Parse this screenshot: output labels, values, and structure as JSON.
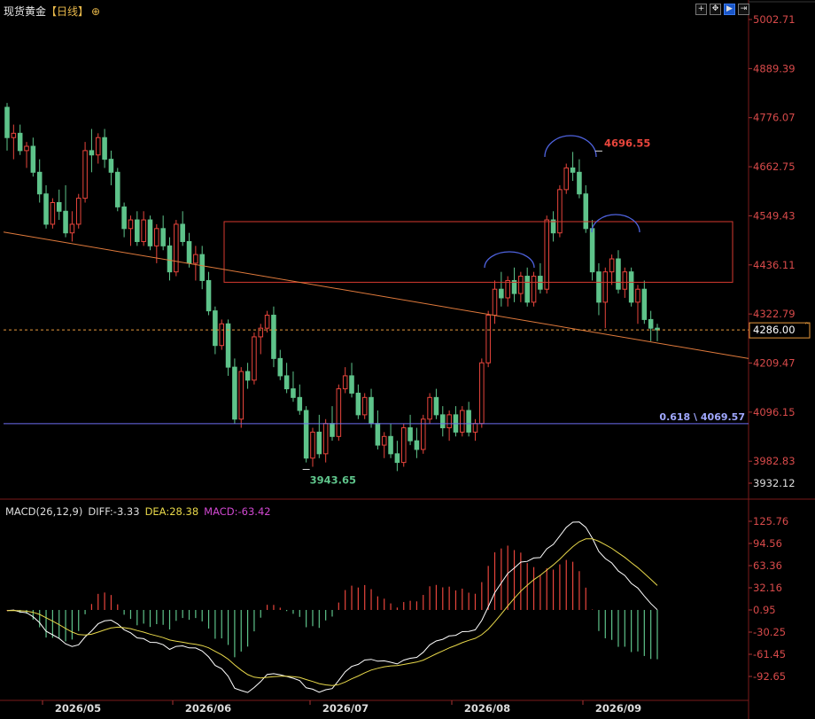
{
  "header": {
    "instrument": "现货黄金",
    "period": "【日线】",
    "add_icon": "plus-circle-icon"
  },
  "toolbar": {
    "buttons": [
      "crosshair-icon",
      "move-icon",
      "play-icon",
      "scroll-icon"
    ]
  },
  "price_axis": {
    "ticks": [
      "5002.71",
      "4889.39",
      "4776.07",
      "4662.75",
      "4549.43",
      "4436.11",
      "4322.79",
      "4209.47",
      "4096.15",
      "3982.83",
      "3932.12"
    ],
    "current_price": "4286.00"
  },
  "annotations": {
    "high_label": "4696.55",
    "low_label": "3943.65",
    "fib_label": "0.618 \\ 4069.57"
  },
  "macd": {
    "name": "MACD(26,12,9)",
    "diff": "DIFF:-3.33",
    "dea": "DEA:28.38",
    "macd": "MACD:-63.42",
    "ticks": [
      "125.76",
      "94.56",
      "63.36",
      "32.16",
      "0.95",
      "-30.25",
      "-61.45",
      "-92.65"
    ]
  },
  "time_axis": {
    "labels": [
      "2026/05",
      "2026/06",
      "2026/07",
      "2026/08",
      "2026/09"
    ]
  },
  "colors": {
    "up": "#e8453c",
    "down": "#5ec38a",
    "rect": "#d63a2f",
    "trendline": "#e07a3c",
    "fib": "#6e6ef0",
    "arc": "#4f63e0",
    "current": "#e89a3c",
    "diff": "#ffffff",
    "dea": "#e8d84a"
  },
  "chart_data": {
    "type": "candlestick",
    "x": [
      "2026/05",
      "2026/06",
      "2026/07",
      "2026/08",
      "2026/09"
    ],
    "ylim": [
      3932.12,
      5002.71
    ],
    "high": 4696.55,
    "low": 3943.65,
    "fib": {
      "ratio": 0.618,
      "value": 4069.57
    },
    "last": 4286.0,
    "rect_range": [
      4396,
      4536
    ],
    "candles": [
      [
        4800,
        4810,
        4700,
        4730
      ],
      [
        4730,
        4760,
        4680,
        4740
      ],
      [
        4740,
        4760,
        4690,
        4700
      ],
      [
        4700,
        4720,
        4660,
        4710
      ],
      [
        4710,
        4730,
        4640,
        4650
      ],
      [
        4650,
        4680,
        4580,
        4600
      ],
      [
        4600,
        4620,
        4520,
        4530
      ],
      [
        4530,
        4590,
        4520,
        4580
      ],
      [
        4580,
        4610,
        4540,
        4560
      ],
      [
        4560,
        4620,
        4500,
        4510
      ],
      [
        4510,
        4560,
        4490,
        4530
      ],
      [
        4530,
        4600,
        4520,
        4590
      ],
      [
        4590,
        4720,
        4580,
        4700
      ],
      [
        4700,
        4750,
        4650,
        4690
      ],
      [
        4690,
        4740,
        4670,
        4730
      ],
      [
        4730,
        4750,
        4660,
        4680
      ],
      [
        4680,
        4700,
        4620,
        4650
      ],
      [
        4650,
        4660,
        4560,
        4570
      ],
      [
        4570,
        4580,
        4500,
        4520
      ],
      [
        4520,
        4550,
        4480,
        4540
      ],
      [
        4540,
        4560,
        4480,
        4490
      ],
      [
        4490,
        4560,
        4480,
        4540
      ],
      [
        4540,
        4550,
        4470,
        4480
      ],
      [
        4480,
        4530,
        4440,
        4520
      ],
      [
        4520,
        4550,
        4470,
        4480
      ],
      [
        4480,
        4500,
        4400,
        4420
      ],
      [
        4420,
        4540,
        4410,
        4530
      ],
      [
        4530,
        4560,
        4480,
        4490
      ],
      [
        4490,
        4510,
        4430,
        4440
      ],
      [
        4440,
        4480,
        4400,
        4460
      ],
      [
        4460,
        4480,
        4380,
        4400
      ],
      [
        4400,
        4420,
        4320,
        4330
      ],
      [
        4330,
        4340,
        4230,
        4250
      ],
      [
        4250,
        4310,
        4240,
        4300
      ],
      [
        4300,
        4310,
        4180,
        4200
      ],
      [
        4200,
        4220,
        4070,
        4080
      ],
      [
        4080,
        4200,
        4060,
        4190
      ],
      [
        4190,
        4210,
        4150,
        4170
      ],
      [
        4170,
        4280,
        4160,
        4270
      ],
      [
        4270,
        4300,
        4230,
        4290
      ],
      [
        4290,
        4330,
        4280,
        4320
      ],
      [
        4320,
        4340,
        4200,
        4220
      ],
      [
        4220,
        4240,
        4170,
        4180
      ],
      [
        4180,
        4210,
        4140,
        4150
      ],
      [
        4150,
        4190,
        4120,
        4130
      ],
      [
        4130,
        4160,
        4090,
        4100
      ],
      [
        4100,
        4110,
        3980,
        3990
      ],
      [
        3990,
        4060,
        3970,
        4050
      ],
      [
        4050,
        4090,
        3990,
        4000
      ],
      [
        4000,
        4080,
        3980,
        4070
      ],
      [
        4070,
        4110,
        4030,
        4040
      ],
      [
        4040,
        4160,
        4030,
        4150
      ],
      [
        4150,
        4200,
        4140,
        4180
      ],
      [
        4180,
        4210,
        4130,
        4140
      ],
      [
        4140,
        4160,
        4080,
        4090
      ],
      [
        4090,
        4140,
        4080,
        4130
      ],
      [
        4130,
        4150,
        4060,
        4070
      ],
      [
        4070,
        4100,
        4010,
        4020
      ],
      [
        4020,
        4050,
        3990,
        4040
      ],
      [
        4040,
        4070,
        3990,
        4000
      ],
      [
        4000,
        4030,
        3960,
        3980
      ],
      [
        3980,
        4070,
        3970,
        4060
      ],
      [
        4060,
        4090,
        4020,
        4030
      ],
      [
        4030,
        4060,
        3990,
        4010
      ],
      [
        4010,
        4090,
        4000,
        4080
      ],
      [
        4080,
        4140,
        4070,
        4130
      ],
      [
        4130,
        4150,
        4080,
        4090
      ],
      [
        4090,
        4110,
        4040,
        4060
      ],
      [
        4060,
        4100,
        4030,
        4090
      ],
      [
        4090,
        4110,
        4040,
        4050
      ],
      [
        4050,
        4110,
        4040,
        4100
      ],
      [
        4100,
        4120,
        4040,
        4050
      ],
      [
        4050,
        4080,
        4030,
        4070
      ],
      [
        4070,
        4220,
        4060,
        4210
      ],
      [
        4210,
        4330,
        4200,
        4320
      ],
      [
        4320,
        4400,
        4300,
        4380
      ],
      [
        4380,
        4420,
        4340,
        4360
      ],
      [
        4360,
        4410,
        4340,
        4400
      ],
      [
        4400,
        4430,
        4350,
        4370
      ],
      [
        4370,
        4420,
        4350,
        4410
      ],
      [
        4410,
        4430,
        4340,
        4350
      ],
      [
        4350,
        4420,
        4340,
        4410
      ],
      [
        4410,
        4440,
        4370,
        4380
      ],
      [
        4380,
        4550,
        4370,
        4540
      ],
      [
        4540,
        4560,
        4490,
        4510
      ],
      [
        4510,
        4620,
        4500,
        4610
      ],
      [
        4610,
        4670,
        4600,
        4660
      ],
      [
        4660,
        4697,
        4630,
        4650
      ],
      [
        4650,
        4680,
        4590,
        4600
      ],
      [
        4600,
        4620,
        4510,
        4520
      ],
      [
        4520,
        4540,
        4400,
        4420
      ],
      [
        4420,
        4440,
        4320,
        4350
      ],
      [
        4350,
        4430,
        4290,
        4420
      ],
      [
        4420,
        4460,
        4390,
        4450
      ],
      [
        4450,
        4470,
        4370,
        4380
      ],
      [
        4380,
        4430,
        4360,
        4420
      ],
      [
        4420,
        4430,
        4340,
        4350
      ],
      [
        4350,
        4390,
        4300,
        4380
      ],
      [
        4380,
        4400,
        4300,
        4310
      ],
      [
        4310,
        4330,
        4260,
        4290
      ],
      [
        4290,
        4300,
        4260,
        4286
      ]
    ]
  }
}
